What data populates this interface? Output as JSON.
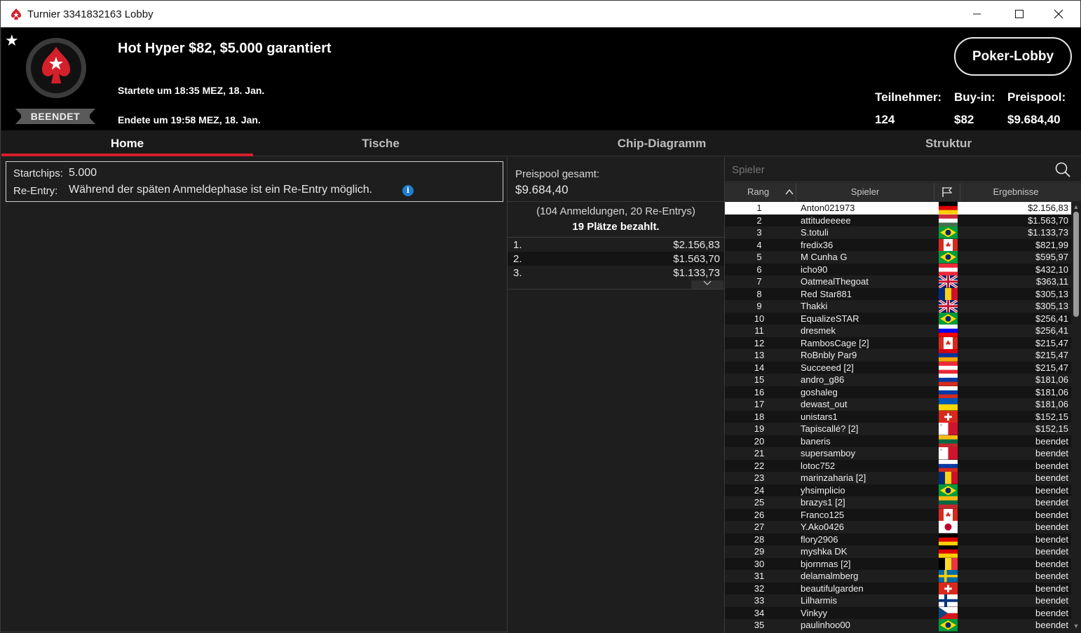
{
  "window": {
    "title": "Turnier 3341832163 Lobby"
  },
  "header": {
    "tournament_name": "Hot Hyper $82, $5.000 garantiert",
    "started": "Startete um 18:35 MEZ, 18. Jan.",
    "ended": "Endete um 19:58 MEZ, 18. Jan.",
    "status": "BEENDET",
    "lobby_button": "Poker-Lobby",
    "stats": [
      {
        "label": "Teilnehmer:",
        "value": "124"
      },
      {
        "label": "Buy-in:",
        "value": "$82"
      },
      {
        "label": "Preispool:",
        "value": "$9.684,40"
      }
    ]
  },
  "tabs": [
    {
      "label": "Home",
      "active": true
    },
    {
      "label": "Tische",
      "active": false
    },
    {
      "label": "Chip-Diagramm",
      "active": false
    },
    {
      "label": "Struktur",
      "active": false
    }
  ],
  "info": {
    "startchips_label": "Startchips:",
    "startchips_value": "5.000",
    "reentry_label": "Re-Entry:",
    "reentry_value": "Während der späten Anmeldephase ist ein Re-Entry möglich.",
    "info_icon": "i"
  },
  "prize_pool": {
    "label": "Preispool gesamt:",
    "value": "$9.684,40",
    "registrations": "(104 Anmeldungen, 20 Re-Entrys)",
    "places_paid": "19 Plätze bezahlt.",
    "payouts": [
      {
        "pos": "1.",
        "amount": "$2.156,83"
      },
      {
        "pos": "2.",
        "amount": "$1.563,70"
      },
      {
        "pos": "3.",
        "amount": "$1.133,73"
      }
    ],
    "expand_icon": "chevron-down-icon"
  },
  "players": {
    "search_placeholder": "Spieler",
    "columns": {
      "rank": "Rang",
      "player": "Spieler",
      "result": "Ergebnisse"
    },
    "sort_icon": "chevron-up-icon",
    "flag_column_icon": "flag-icon",
    "rows": [
      {
        "rank": "1",
        "name": "Anton021973",
        "flag": "DE",
        "result": "$2.156,83"
      },
      {
        "rank": "2",
        "name": "attitudeeeee",
        "flag": "HU",
        "result": "$1.563,70"
      },
      {
        "rank": "3",
        "name": "S.totuli",
        "flag": "BR",
        "result": "$1.133,73"
      },
      {
        "rank": "4",
        "name": "fredix36",
        "flag": "CA",
        "result": "$821,99"
      },
      {
        "rank": "5",
        "name": "M Cunha G",
        "flag": "BR",
        "result": "$595,97"
      },
      {
        "rank": "6",
        "name": "icho90",
        "flag": "AT",
        "result": "$432,10"
      },
      {
        "rank": "7",
        "name": "OatmealThegoat",
        "flag": "GB",
        "result": "$363,11"
      },
      {
        "rank": "8",
        "name": "Red Star881",
        "flag": "RO",
        "result": "$305,13"
      },
      {
        "rank": "9",
        "name": "Thakki",
        "flag": "GB",
        "result": "$305,13"
      },
      {
        "rank": "10",
        "name": "EqualizeSTAR",
        "flag": "BR",
        "result": "$256,41"
      },
      {
        "rank": "11",
        "name": "dresmek",
        "flag": "SI",
        "result": "$256,41"
      },
      {
        "rank": "12",
        "name": "RambosCage [2]",
        "flag": "CA",
        "result": "$215,47"
      },
      {
        "rank": "13",
        "name": "RoBnbly Par9",
        "flag": "AM",
        "result": "$215,47"
      },
      {
        "rank": "14",
        "name": "Succeeed [2]",
        "flag": "AT",
        "result": "$215,47"
      },
      {
        "rank": "15",
        "name": "andro_g86",
        "flag": "RU",
        "result": "$181,06"
      },
      {
        "rank": "16",
        "name": "goshaleg",
        "flag": "RU",
        "result": "$181,06"
      },
      {
        "rank": "17",
        "name": "dewast_out",
        "flag": "UA",
        "result": "$181,06"
      },
      {
        "rank": "18",
        "name": "unistars1",
        "flag": "CH",
        "result": "$152,15"
      },
      {
        "rank": "19",
        "name": "Tapiscallé? [2]",
        "flag": "MT",
        "result": "$152,15"
      },
      {
        "rank": "20",
        "name": "baneris",
        "flag": "LT",
        "result": "beendet"
      },
      {
        "rank": "21",
        "name": "supersamboy",
        "flag": "MT",
        "result": "beendet"
      },
      {
        "rank": "22",
        "name": "lotoc752",
        "flag": "RU",
        "result": "beendet"
      },
      {
        "rank": "23",
        "name": "marinzaharia [2]",
        "flag": "RO",
        "result": "beendet"
      },
      {
        "rank": "24",
        "name": "yhsimplicio",
        "flag": "BR",
        "result": "beendet"
      },
      {
        "rank": "25",
        "name": "brazys1 [2]",
        "flag": "LT",
        "result": "beendet"
      },
      {
        "rank": "26",
        "name": "Franco125",
        "flag": "CA",
        "result": "beendet"
      },
      {
        "rank": "27",
        "name": "Y.Ako0426",
        "flag": "JP",
        "result": "beendet"
      },
      {
        "rank": "28",
        "name": "flory2906",
        "flag": "DE",
        "result": "beendet"
      },
      {
        "rank": "29",
        "name": "myshka DK",
        "flag": "DE",
        "result": "beendet"
      },
      {
        "rank": "30",
        "name": "bjornmas [2]",
        "flag": "BE",
        "result": "beendet"
      },
      {
        "rank": "31",
        "name": "delamalmberg",
        "flag": "SE",
        "result": "beendet"
      },
      {
        "rank": "32",
        "name": "beautifulgarden",
        "flag": "CH",
        "result": "beendet"
      },
      {
        "rank": "33",
        "name": "Lilharmis",
        "flag": "FI",
        "result": "beendet"
      },
      {
        "rank": "34",
        "name": "Vinkyy",
        "flag": "CZ",
        "result": "beendet"
      },
      {
        "rank": "35",
        "name": "paulinhoo00",
        "flag": "BR",
        "result": "beendet"
      }
    ]
  },
  "colors": {
    "accent": "#d3202a",
    "background": "#1e1e1e",
    "header": "#000000",
    "selected_row": "#ffffff"
  }
}
